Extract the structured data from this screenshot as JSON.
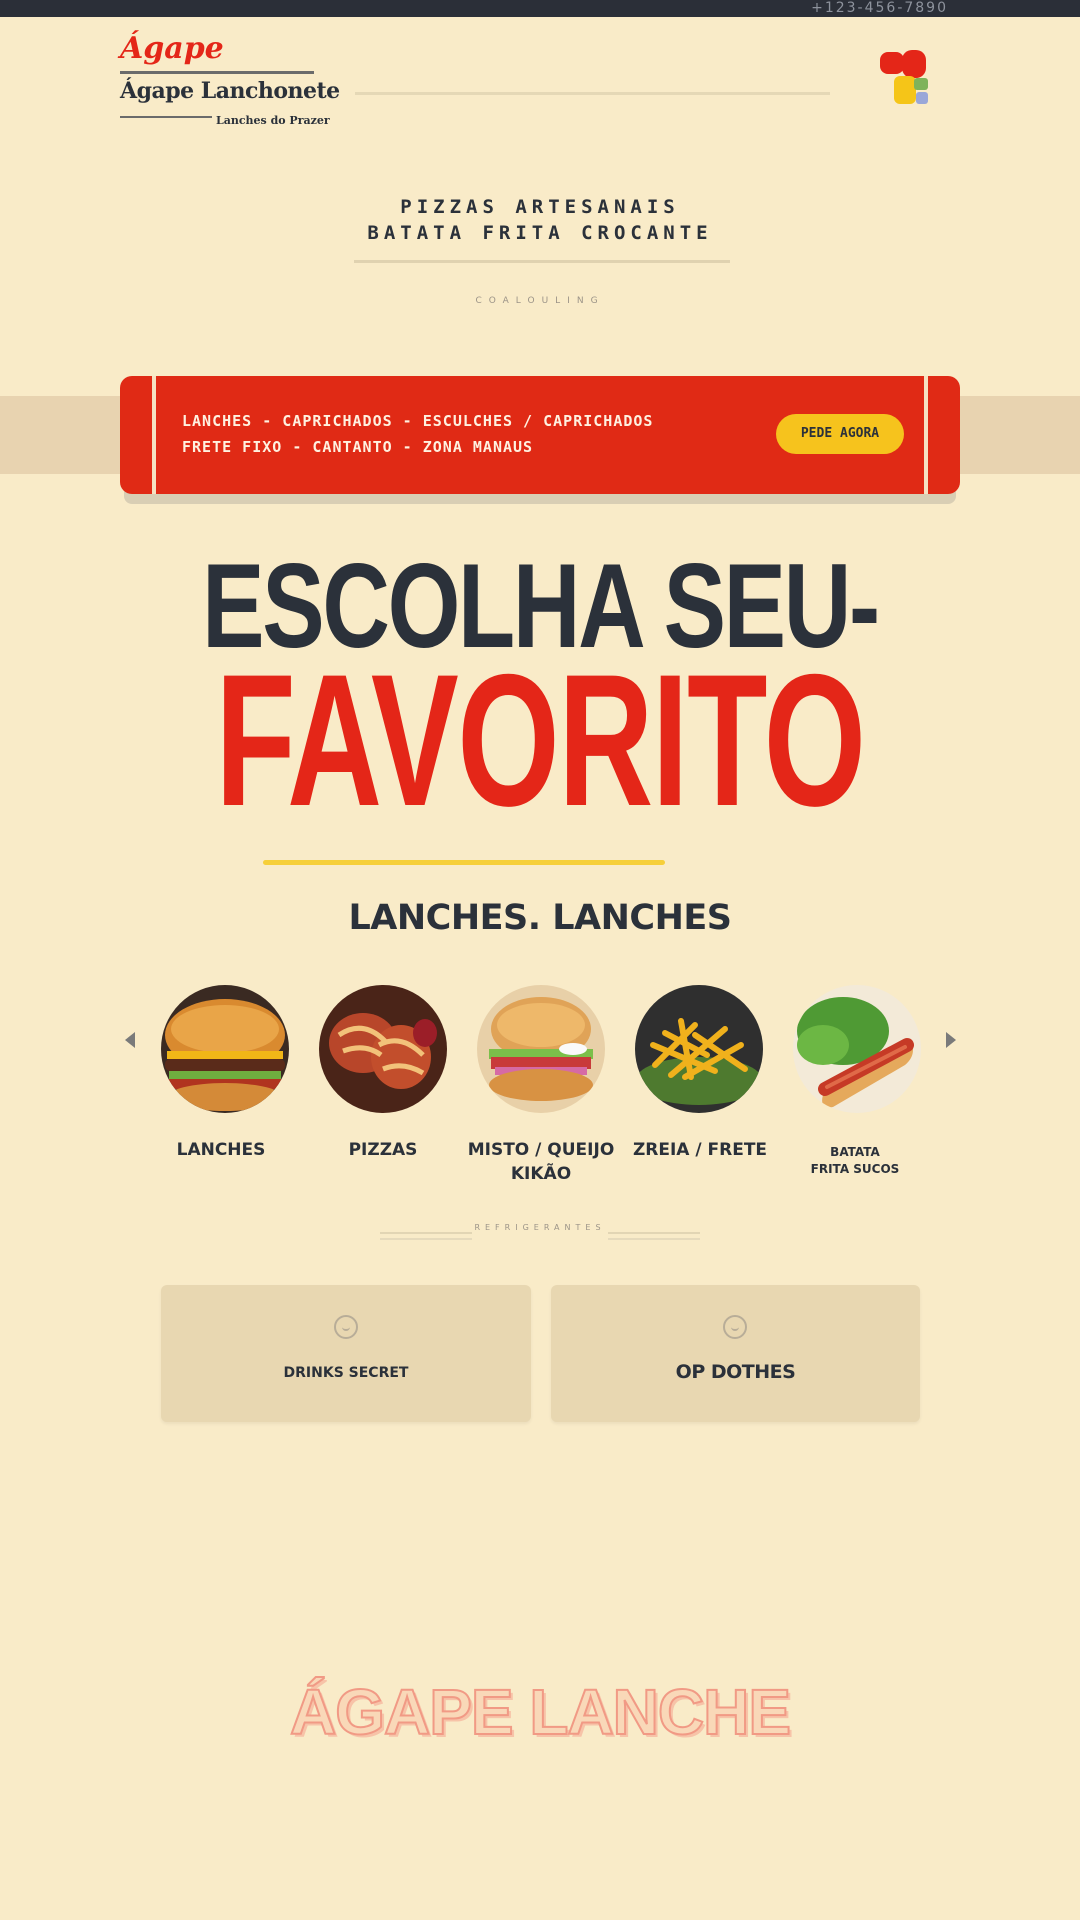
{
  "topbar": {
    "phone": "+123-456-7890"
  },
  "logo": {
    "script": "Ágape",
    "name": "Ágape Lanchonete",
    "tagline": "Lanches do Prazer"
  },
  "header": {
    "cart_icon": "cart-icon"
  },
  "intro": {
    "line1": "PIZZAS ARTESANAIS",
    "line2": "BATATA FRITA CROCANTE",
    "small_caption": "COALOULING"
  },
  "banner": {
    "line1": "LANCHES - CAPRICHADOS - ESCULCHES / CAPRICHADOS",
    "line2": "FRETE FIXO - CANTANTO - ZONA MANAUS",
    "cta": "PEDE AGORA",
    "colors": {
      "background": "#e02a15",
      "button": "#f6c31d"
    }
  },
  "hero": {
    "line1": "ESCOLHA SEU-",
    "line2": "FAVORITO"
  },
  "categories": {
    "title": "LANCHES. LANCHES",
    "items": [
      {
        "label": "LANCHES",
        "image": "burger-photo"
      },
      {
        "label": "PIZZAS",
        "image": "pizza-rolls-photo"
      },
      {
        "label": "MISTO / QUEIJO KIKÃO",
        "image": "burger-photo"
      },
      {
        "label": "ZREIA / FRETE",
        "image": "fries-photo"
      },
      {
        "label": "BATATA FRITA SUCOS",
        "image": "hotdog-photo"
      }
    ]
  },
  "subsection": {
    "caption": "REFRIGERANTES"
  },
  "cards": [
    {
      "label": "DRINKS SECRET",
      "icon": "smile-icon"
    },
    {
      "label": "OP DOTHES",
      "icon": "smile-icon"
    }
  ],
  "footer": {
    "brand": "ÁGAPE LANCHE"
  }
}
